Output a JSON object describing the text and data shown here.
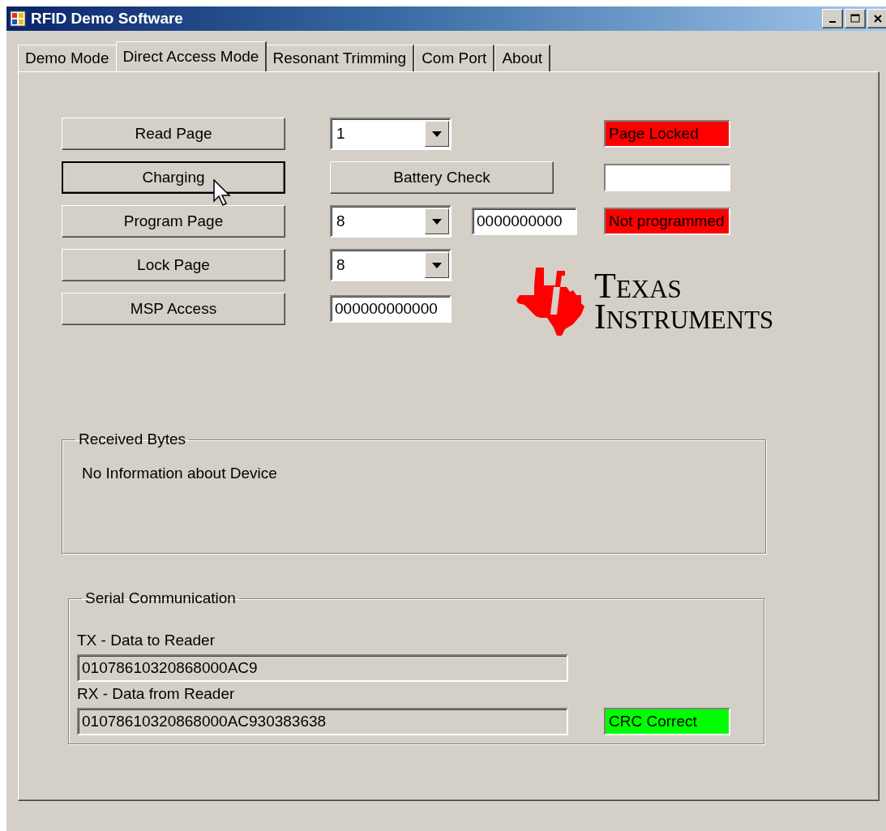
{
  "window": {
    "title": "RFID Demo Software"
  },
  "tabs": [
    {
      "label": "Demo Mode",
      "selected": false
    },
    {
      "label": "Direct Access Mode",
      "selected": true
    },
    {
      "label": "Resonant Trimming",
      "selected": false
    },
    {
      "label": "Com Port",
      "selected": false
    },
    {
      "label": "About",
      "selected": false
    }
  ],
  "rows": [
    {
      "button": {
        "label": "Read Page",
        "focused": false
      },
      "combo": {
        "value": "1"
      },
      "status": {
        "text": "Page Locked",
        "color": "#ff0000"
      }
    },
    {
      "button": {
        "label": "Charging",
        "focused": true
      },
      "wide_button": {
        "label": "Battery Check"
      },
      "status": {
        "color": "#ffffff"
      }
    },
    {
      "button": {
        "label": "Program Page",
        "focused": false
      },
      "combo": {
        "value": "8"
      },
      "field": {
        "value": "0000000000"
      },
      "status": {
        "text": "Not programmed",
        "color": "#ff0000"
      }
    },
    {
      "button": {
        "label": "Lock Page",
        "focused": false
      },
      "combo": {
        "value": "8"
      }
    },
    {
      "button": {
        "label": "MSP Access",
        "focused": false
      },
      "field": {
        "value": "000000000000"
      }
    }
  ],
  "logo": {
    "line1": "Texas",
    "line2": "Instruments"
  },
  "received_bytes": {
    "title": "Received Bytes",
    "text": "No Information about Device"
  },
  "serial": {
    "title": "Serial Communication",
    "tx_label": "TX - Data to Reader",
    "tx": "01078610320868000AC9",
    "rx_label": "RX - Data from Reader",
    "rx": "01078610320868000AC930383638",
    "crc": {
      "text": "CRC Correct",
      "color": "#00ff00"
    }
  }
}
